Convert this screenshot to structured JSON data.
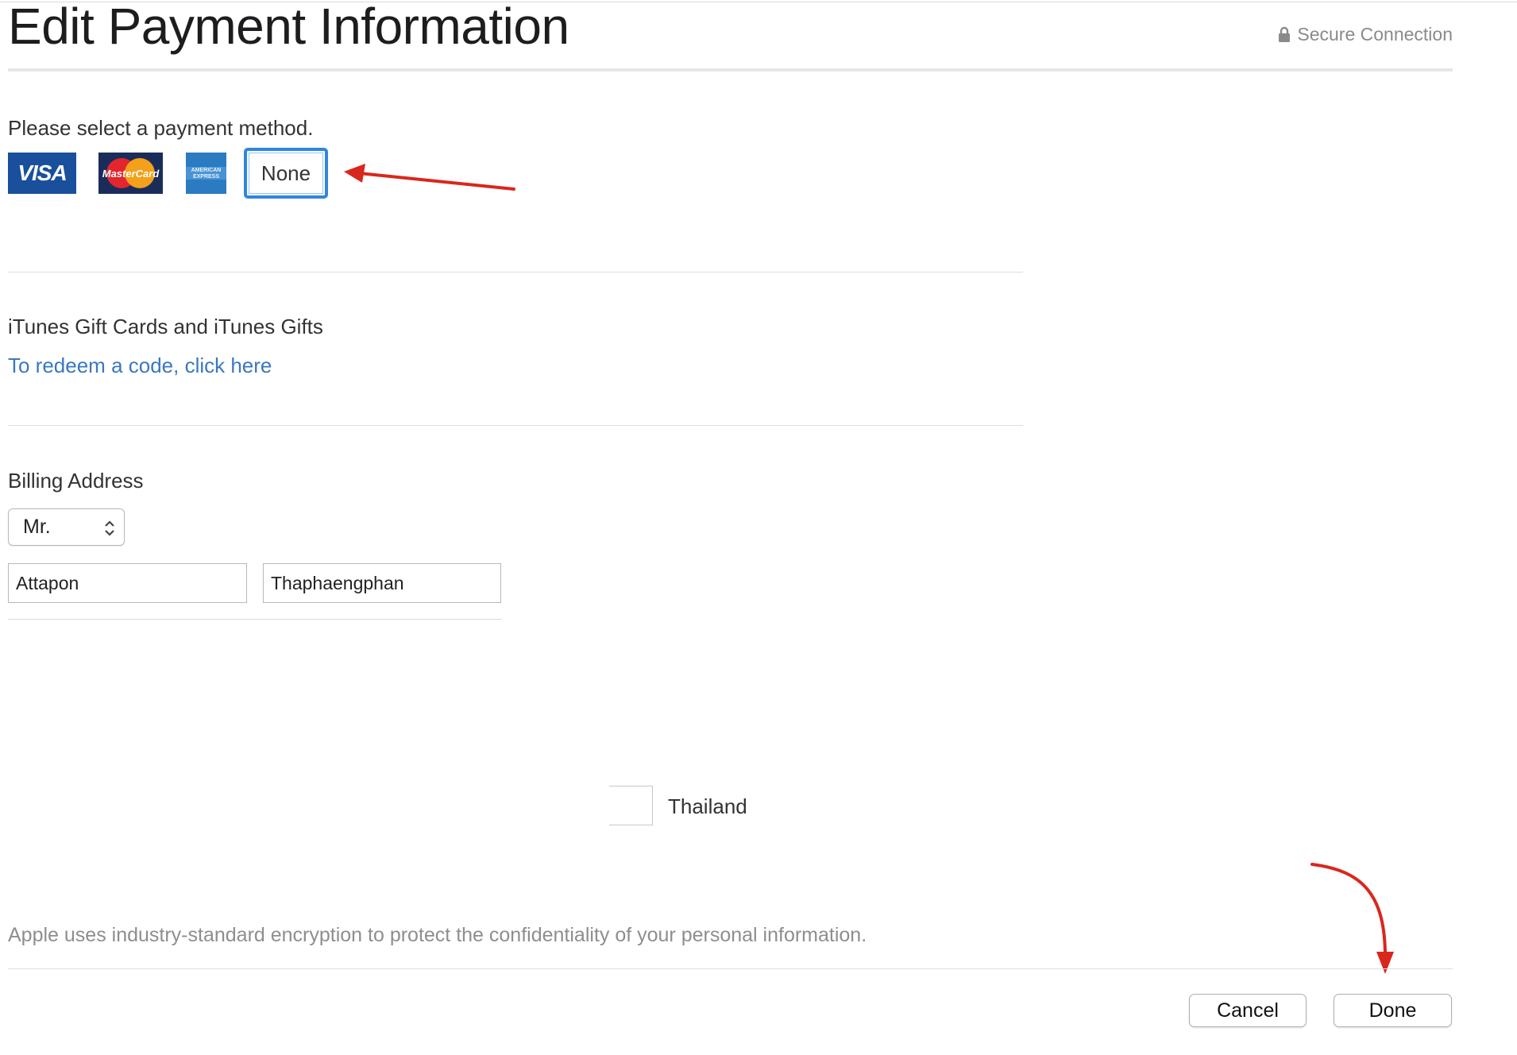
{
  "header": {
    "title": "Edit Payment Information",
    "secure_label": "Secure Connection"
  },
  "payment": {
    "prompt": "Please select a payment method.",
    "options": [
      {
        "id": "visa",
        "label": "VISA",
        "selected": false
      },
      {
        "id": "mastercard",
        "label": "MasterCard",
        "selected": false
      },
      {
        "id": "amex",
        "label": "AMERICAN EXPRESS",
        "selected": false
      },
      {
        "id": "none",
        "label": "None",
        "selected": true
      }
    ]
  },
  "gift": {
    "heading": "iTunes Gift Cards and iTunes Gifts",
    "redeem_link": "To redeem a code, click here"
  },
  "billing": {
    "heading": "Billing Address",
    "salutation": "Mr.",
    "first_name": "Attapon",
    "last_name": "Thaphaengphan",
    "country": "Thailand"
  },
  "footer": {
    "encryption_note": "Apple uses industry-standard encryption to protect the confidentiality of your personal information.",
    "cancel_label": "Cancel",
    "done_label": "Done"
  },
  "colors": {
    "selected_border": "#2f86e0",
    "link": "#3a78c0",
    "annotation_arrow": "#d9271d",
    "visa_blue": "#1a4f9c",
    "amex_blue": "#2a7bc2"
  },
  "icons": [
    "lock-icon",
    "updown-chevron-icon"
  ]
}
